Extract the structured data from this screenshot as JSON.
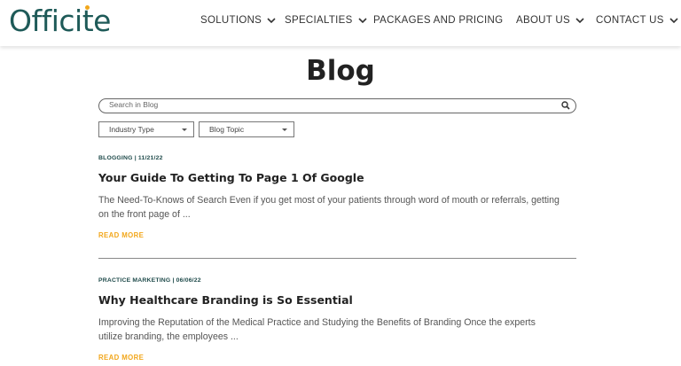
{
  "header": {
    "logo_text": "Officite",
    "nav": [
      {
        "label": "SOLUTIONS",
        "has_dropdown": true
      },
      {
        "label": "SPECIALTIES",
        "has_dropdown": true
      },
      {
        "label": "PACKAGES AND PRICING",
        "has_dropdown": false
      },
      {
        "label": "ABOUT US",
        "has_dropdown": true
      },
      {
        "label": "CONTACT US",
        "has_dropdown": true
      }
    ]
  },
  "page": {
    "title": "Blog",
    "search": {
      "placeholder": "Search in Blog"
    },
    "filters": [
      {
        "label": "Industry Type"
      },
      {
        "label": "Blog Topic"
      }
    ]
  },
  "posts": [
    {
      "meta": "BLOGGING | 11/21/22",
      "title": "Your Guide To Getting To Page 1 Of Google",
      "excerpt_line1": "The Need-To-Knows of Search Even if you get most of your patients through word of mouth or referrals, getting",
      "excerpt_line2": "on the front page of ...",
      "read_more": "READ MORE"
    },
    {
      "meta": "PRACTICE MARKETING | 06/06/22",
      "title": "Why Healthcare Branding is So Essential",
      "excerpt_line1": "Improving the Reputation of the Medical Practice and Studying the Benefits of Branding Once the experts",
      "excerpt_line2": "utilize branding, the employees ...",
      "read_more": "READ MORE"
    }
  ],
  "colors": {
    "brand": "#1e5a58",
    "accent": "#f2a71b",
    "text": "#222222",
    "muted": "#555555"
  },
  "icons": {
    "search": "search-icon",
    "nav_caret": "chevron-down-icon",
    "select_caret": "caret-down-icon"
  }
}
